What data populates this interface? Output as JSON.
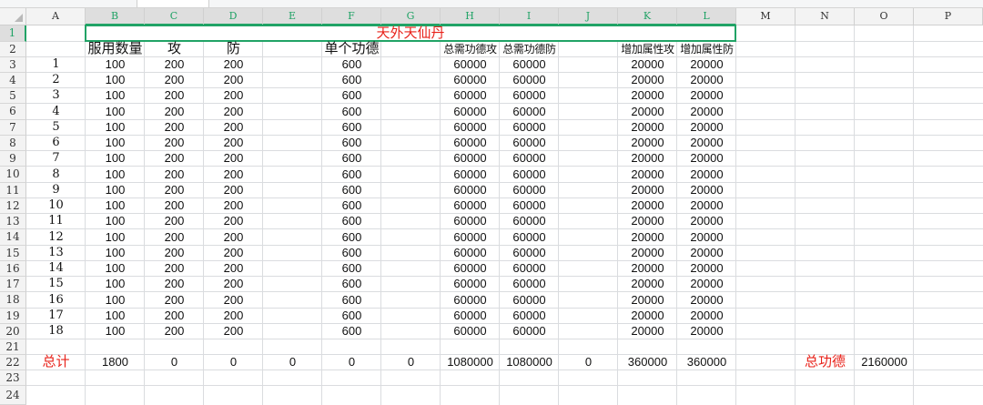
{
  "columns": [
    "A",
    "B",
    "C",
    "D",
    "E",
    "F",
    "G",
    "H",
    "I",
    "J",
    "K",
    "L",
    "M",
    "N",
    "O",
    "P"
  ],
  "rows": [
    "1",
    "2",
    "3",
    "4",
    "5",
    "6",
    "7",
    "8",
    "9",
    "10",
    "11",
    "12",
    "13",
    "14",
    "15",
    "16",
    "17",
    "18",
    "19",
    "20",
    "21",
    "22",
    "23",
    "24"
  ],
  "title": "天外天仙丹",
  "headers": {
    "B": "服用数量",
    "C": "攻",
    "D": "防",
    "F": "单个功德",
    "H": "总需功德攻",
    "I": "总需功德防",
    "K": "增加属性攻",
    "L": "增加属性防"
  },
  "data_rows": [
    [
      "1",
      "100",
      "200",
      "200",
      "600",
      "60000",
      "60000",
      "20000",
      "20000"
    ],
    [
      "2",
      "100",
      "200",
      "200",
      "600",
      "60000",
      "60000",
      "20000",
      "20000"
    ],
    [
      "3",
      "100",
      "200",
      "200",
      "600",
      "60000",
      "60000",
      "20000",
      "20000"
    ],
    [
      "4",
      "100",
      "200",
      "200",
      "600",
      "60000",
      "60000",
      "20000",
      "20000"
    ],
    [
      "5",
      "100",
      "200",
      "200",
      "600",
      "60000",
      "60000",
      "20000",
      "20000"
    ],
    [
      "6",
      "100",
      "200",
      "200",
      "600",
      "60000",
      "60000",
      "20000",
      "20000"
    ],
    [
      "7",
      "100",
      "200",
      "200",
      "600",
      "60000",
      "60000",
      "20000",
      "20000"
    ],
    [
      "8",
      "100",
      "200",
      "200",
      "600",
      "60000",
      "60000",
      "20000",
      "20000"
    ],
    [
      "9",
      "100",
      "200",
      "200",
      "600",
      "60000",
      "60000",
      "20000",
      "20000"
    ],
    [
      "10",
      "100",
      "200",
      "200",
      "600",
      "60000",
      "60000",
      "20000",
      "20000"
    ],
    [
      "11",
      "100",
      "200",
      "200",
      "600",
      "60000",
      "60000",
      "20000",
      "20000"
    ],
    [
      "12",
      "100",
      "200",
      "200",
      "600",
      "60000",
      "60000",
      "20000",
      "20000"
    ],
    [
      "13",
      "100",
      "200",
      "200",
      "600",
      "60000",
      "60000",
      "20000",
      "20000"
    ],
    [
      "14",
      "100",
      "200",
      "200",
      "600",
      "60000",
      "60000",
      "20000",
      "20000"
    ],
    [
      "15",
      "100",
      "200",
      "200",
      "600",
      "60000",
      "60000",
      "20000",
      "20000"
    ],
    [
      "16",
      "100",
      "200",
      "200",
      "600",
      "60000",
      "60000",
      "20000",
      "20000"
    ],
    [
      "17",
      "100",
      "200",
      "200",
      "600",
      "60000",
      "60000",
      "20000",
      "20000"
    ],
    [
      "18",
      "100",
      "200",
      "200",
      "600",
      "60000",
      "60000",
      "20000",
      "20000"
    ]
  ],
  "totals": {
    "label": "总计",
    "B": "1800",
    "C": "0",
    "D": "0",
    "E": "0",
    "F": "0",
    "G": "0",
    "H": "1080000",
    "I": "1080000",
    "J": "0",
    "K": "360000",
    "L": "360000",
    "N": "总功德",
    "O": "2160000"
  },
  "colors": {
    "selection": "#21a366",
    "red_text": "#e8221a",
    "gridline": "#dadcdf"
  }
}
